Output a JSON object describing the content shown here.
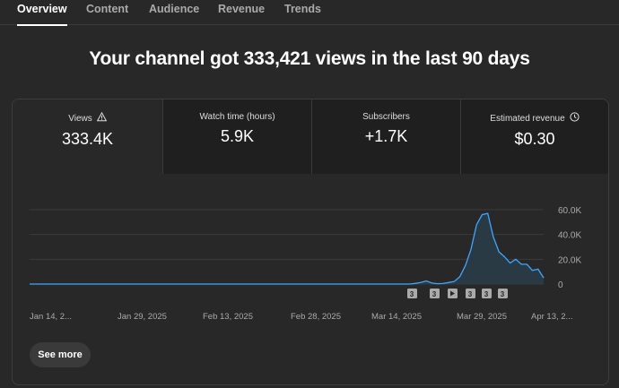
{
  "tabs": [
    {
      "label": "Overview"
    },
    {
      "label": "Content"
    },
    {
      "label": "Audience"
    },
    {
      "label": "Revenue"
    },
    {
      "label": "Trends"
    }
  ],
  "headline": "Your channel got 333,421 views in the last 90 days",
  "metrics": [
    {
      "label": "Views",
      "value": "333.4K",
      "icon": "warning-icon"
    },
    {
      "label": "Watch time (hours)",
      "value": "5.9K"
    },
    {
      "label": "Subscribers",
      "value": "+1.7K"
    },
    {
      "label": "Estimated revenue",
      "value": "$0.30",
      "icon": "clock-icon"
    }
  ],
  "see_more_label": "See more",
  "colors": {
    "line": "#3ea6ff",
    "area": "#2a3a44",
    "grid": "#3a3a3a"
  },
  "markers": [
    {
      "label": "3",
      "type": "number"
    },
    {
      "label": "3",
      "type": "number"
    },
    {
      "label": "",
      "type": "play-icon"
    },
    {
      "label": "3",
      "type": "number"
    },
    {
      "label": "3",
      "type": "number"
    },
    {
      "label": "3",
      "type": "number"
    }
  ],
  "chart_data": {
    "type": "area",
    "ylim": [
      0,
      60000
    ],
    "yticks": [
      "60.0K",
      "40.0K",
      "20.0K",
      "0"
    ],
    "xticks": [
      "Jan 14, 2...",
      "Jan 29, 2025",
      "Feb 13, 2025",
      "Feb 28, 2025",
      "Mar 14, 2025",
      "Mar 29, 2025",
      "Apr 13, 2..."
    ],
    "series": [
      {
        "values": [
          0,
          0,
          0,
          0,
          0,
          0,
          0,
          0,
          0,
          0,
          0,
          0,
          0,
          0,
          0,
          0,
          0,
          0,
          0,
          0,
          0,
          0,
          0,
          0,
          0,
          0,
          0,
          0,
          0,
          0,
          0,
          0,
          0,
          0,
          0,
          0,
          0,
          0,
          0,
          0,
          0,
          0,
          0,
          0,
          0,
          0,
          0,
          0,
          0,
          0,
          0,
          0,
          0,
          0,
          0,
          0,
          0,
          0,
          0,
          0,
          0,
          0,
          0,
          0,
          0,
          0,
          0,
          0,
          0,
          500,
          1200,
          2500,
          800,
          300,
          400,
          1200,
          2000,
          6000,
          15000,
          28000,
          48000,
          56000,
          57000,
          38000,
          26000,
          22000,
          17000,
          20000,
          16000,
          16000,
          11000,
          12000,
          5000
        ]
      }
    ]
  }
}
